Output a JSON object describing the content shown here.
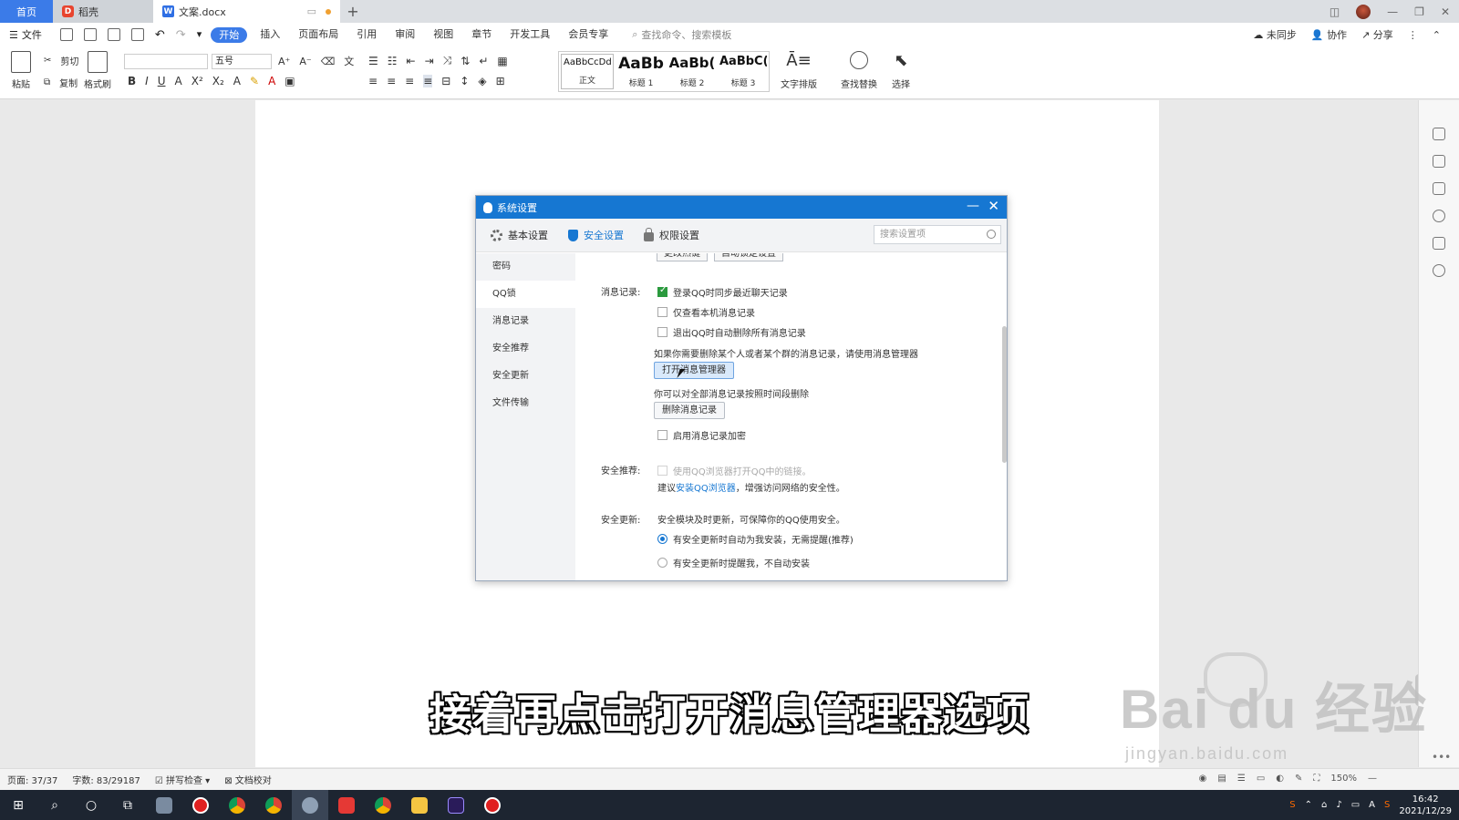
{
  "tabs": {
    "home": "首页",
    "docer": "稻壳",
    "doc": "文案.docx",
    "add": "+"
  },
  "menubar": {
    "file": "文件",
    "items": [
      "开始",
      "插入",
      "页面布局",
      "引用",
      "审阅",
      "视图",
      "章节",
      "开发工具",
      "会员专享"
    ],
    "search_placeholder": "查找命令、搜索模板",
    "sync": "未同步",
    "collab": "协作",
    "share": "分享"
  },
  "ribbon": {
    "paste": "粘贴",
    "cut": "剪切",
    "copy": "复制",
    "format_painter": "格式刷",
    "font_size": "五号",
    "styles": [
      {
        "sample": "AaBbCcDd",
        "label": "正文"
      },
      {
        "sample": "AaBb",
        "label": "标题 1"
      },
      {
        "sample": "AaBb(",
        "label": "标题 2"
      },
      {
        "sample": "AaBbC(",
        "label": "标题 3"
      }
    ],
    "text_layout": "文字排版",
    "find_replace": "查找替换",
    "select": "选择"
  },
  "dialog": {
    "title": "系统设置",
    "tabs": [
      "基本设置",
      "安全设置",
      "权限设置"
    ],
    "search_placeholder": "搜索设置项",
    "sidebar": [
      "密码",
      "QQ锁",
      "消息记录",
      "安全推荐",
      "安全更新",
      "文件传输"
    ],
    "top_buttons": [
      "更改热键",
      "自动锁定设置"
    ],
    "msg_record": {
      "label": "消息记录:",
      "opt1": "登录QQ时同步最近聊天记录",
      "opt2": "仅查看本机消息记录",
      "opt3": "退出QQ时自动删除所有消息记录",
      "hint1": "如果你需要删除某个人或者某个群的消息记录，请使用消息管理器",
      "btn_open": "打开消息管理器",
      "hint2": "你可以对全部消息记录按照时间段删除",
      "btn_delete": "删除消息记录",
      "opt4": "启用消息记录加密"
    },
    "safe_recommend": {
      "label": "安全推荐:",
      "opt": "使用QQ浏览器打开QQ中的链接。",
      "hint_pre": "建议",
      "hint_link": "安装QQ浏览器",
      "hint_post": "，增强访问网络的安全性。"
    },
    "safe_update": {
      "label": "安全更新:",
      "desc": "安全模块及时更新，可保障你的QQ使用安全。",
      "opt1": "有安全更新时自动为我安装，无需提醒(推荐)",
      "opt2": "有安全更新时提醒我，不自动安装"
    }
  },
  "subtitle": "接着再点击打开消息管理器选项",
  "watermark": {
    "brand": "Bai du 经验",
    "url": "jingyan.baidu.com"
  },
  "statusbar": {
    "page": "页面: 37/37",
    "words": "字数: 83/29187",
    "spell": "拼写检查",
    "proof": "文档校对",
    "zoom": "150%"
  },
  "taskbar": {
    "time": "16:42",
    "date": "2021/12/29"
  }
}
